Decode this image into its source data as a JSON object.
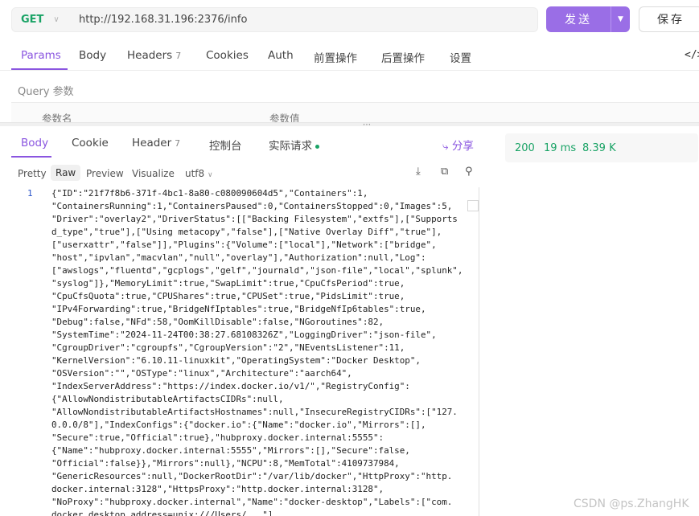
{
  "request": {
    "method": "GET",
    "url": "http://192.168.31.196:2376/info",
    "send_label": "发送",
    "save_label": "保存"
  },
  "req_tabs": [
    {
      "label": "Params"
    },
    {
      "label": "Body"
    },
    {
      "label": "Headers",
      "badge": "7"
    },
    {
      "label": "Cookies"
    },
    {
      "label": "Auth"
    },
    {
      "label": "前置操作"
    },
    {
      "label": "后置操作"
    },
    {
      "label": "设置"
    }
  ],
  "query": {
    "title": "Query 参数",
    "col_name": "参数名",
    "col_value": "参数值"
  },
  "res_tabs": [
    {
      "label": "Body"
    },
    {
      "label": "Cookie"
    },
    {
      "label": "Header",
      "badge": "7"
    },
    {
      "label": "控制台"
    },
    {
      "label": "实际请求"
    }
  ],
  "share_label": "分享",
  "formats": [
    "Pretty",
    "Raw",
    "Preview",
    "Visualize"
  ],
  "encoding": "utf8",
  "status": {
    "code": "200",
    "time": "19 ms",
    "size": "8.39 K"
  },
  "line_number": "1",
  "code_lines": [
    "{\"ID\":\"21f7f8b6-371f-4bc1-8a80-c080090604d5\",\"Containers\":1,",
    "\"ContainersRunning\":1,\"ContainersPaused\":0,\"ContainersStopped\":0,\"Images\":5,",
    "\"Driver\":\"overlay2\",\"DriverStatus\":[[\"Backing Filesystem\",\"extfs\"],[\"Supports",
    "d_type\",\"true\"],[\"Using metacopy\",\"false\"],[\"Native Overlay Diff\",\"true\"],",
    "[\"userxattr\",\"false\"]],\"Plugins\":{\"Volume\":[\"local\"],\"Network\":[\"bridge\",",
    "\"host\",\"ipvlan\",\"macvlan\",\"null\",\"overlay\"],\"Authorization\":null,\"Log\":",
    "[\"awslogs\",\"fluentd\",\"gcplogs\",\"gelf\",\"journald\",\"json-file\",\"local\",\"splunk\",",
    "\"syslog\"]},\"MemoryLimit\":true,\"SwapLimit\":true,\"CpuCfsPeriod\":true,",
    "\"CpuCfsQuota\":true,\"CPUShares\":true,\"CPUSet\":true,\"PidsLimit\":true,",
    "\"IPv4Forwarding\":true,\"BridgeNfIptables\":true,\"BridgeNfIp6tables\":true,",
    "\"Debug\":false,\"NFd\":58,\"OomKillDisable\":false,\"NGoroutines\":82,",
    "\"SystemTime\":\"2024-11-24T00:38:27.68108326Z\",\"LoggingDriver\":\"json-file\",",
    "\"CgroupDriver\":\"cgroupfs\",\"CgroupVersion\":\"2\",\"NEventsListener\":11,",
    "\"KernelVersion\":\"6.10.11-linuxkit\",\"OperatingSystem\":\"Docker Desktop\",",
    "\"OSVersion\":\"\",\"OSType\":\"linux\",\"Architecture\":\"aarch64\",",
    "\"IndexServerAddress\":\"https://index.docker.io/v1/\",\"RegistryConfig\":",
    "{\"AllowNondistributableArtifactsCIDRs\":null,",
    "\"AllowNondistributableArtifactsHostnames\":null,\"InsecureRegistryCIDRs\":[\"127.",
    "0.0.0/8\"],\"IndexConfigs\":{\"docker.io\":{\"Name\":\"docker.io\",\"Mirrors\":[],",
    "\"Secure\":true,\"Official\":true},\"hubproxy.docker.internal:5555\":",
    "{\"Name\":\"hubproxy.docker.internal:5555\",\"Mirrors\":[],\"Secure\":false,",
    "\"Official\":false}},\"Mirrors\":null},\"NCPU\":8,\"MemTotal\":4109737984,",
    "\"GenericResources\":null,\"DockerRootDir\":\"/var/lib/docker\",\"HttpProxy\":\"http.",
    "docker.internal:3128\",\"HttpsProxy\":\"http.docker.internal:3128\",",
    "\"NoProxy\":\"hubproxy.docker.internal\",\"Name\":\"docker-desktop\",\"Labels\":[\"com.",
    "docker.desktop.address=unix:///Users/...\"]"
  ],
  "watermark": "CSDN @ps.ZhangHK",
  "colors": {
    "accent": "#8a55e0",
    "success": "#1aa366",
    "method": "#1aa366"
  }
}
